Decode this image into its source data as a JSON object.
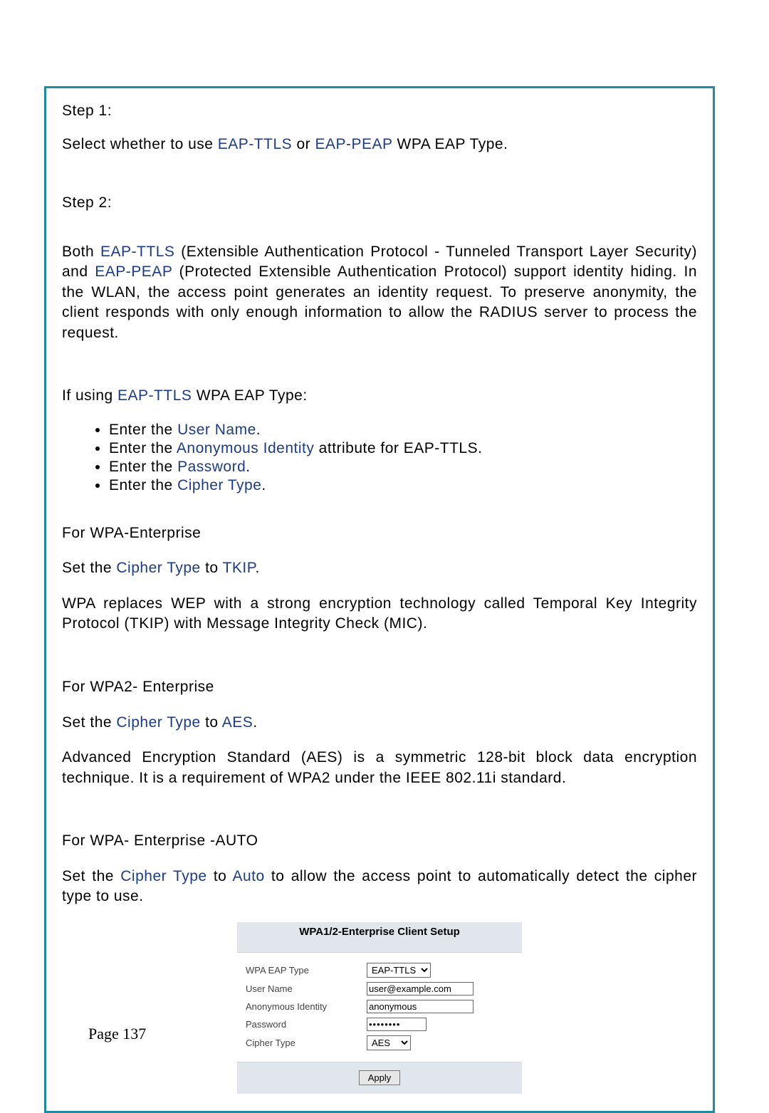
{
  "step1": {
    "title": "Step 1:",
    "text_before": "Select whether to use ",
    "link1": "EAP-TTLS",
    "text_mid": " or ",
    "link2": "EAP-PEAP",
    "text_after": " WPA EAP Type."
  },
  "step2": {
    "title": "Step 2:",
    "para_a": "Both ",
    "link1": "EAP-TTLS",
    "para_b": " (Extensible Authentication Protocol - Tunneled Transport Layer Security) and ",
    "link2": "EAP-PEAP",
    "para_c": " (Protected Extensible Authentication Protocol) support identity hiding. In the WLAN, the access point generates an identity request. To preserve anonymity, the client responds with only enough information to allow the RADIUS server to process the request."
  },
  "ttls_intro_a": "If using ",
  "ttls_intro_link": "EAP-TTLS",
  "ttls_intro_b": " WPA EAP Type:",
  "bullets": [
    {
      "pre": "Enter the ",
      "link": "User Name",
      "post": "."
    },
    {
      "pre": "Enter the ",
      "link": "Anonymous Identity",
      "post": " attribute for EAP-TTLS."
    },
    {
      "pre": "Enter the ",
      "link": "Password",
      "post": "."
    },
    {
      "pre": "Enter the ",
      "link": "Cipher Type",
      "post": "."
    }
  ],
  "wpa1": {
    "head": "For WPA-Enterprise",
    "set_a": "Set the ",
    "set_link1": "Cipher Type",
    "set_b": " to ",
    "set_link2": "TKIP",
    "set_c": ".",
    "body": "WPA replaces WEP with a strong encryption technology called Temporal Key Integrity Protocol (TKIP) with Message Integrity Check (MIC)."
  },
  "wpa2": {
    "head": "For WPA2- Enterprise",
    "set_a": "Set the ",
    "set_link1": "Cipher Type",
    "set_b": " to ",
    "set_link2": "AES",
    "set_c": ".",
    "body": "Advanced Encryption Standard (AES) is a symmetric 128-bit block data encryption technique. It is a requirement of WPA2 under the IEEE 802.11i standard."
  },
  "wpaauto": {
    "head": "For WPA- Enterprise -AUTO",
    "set_a": "Set the ",
    "set_link1": "Cipher Type",
    "set_b": " to ",
    "set_link2": "Auto",
    "set_c": " to allow the access point to automatically detect the cipher type to use."
  },
  "form": {
    "title": "WPA1/2-Enterprise Client Setup",
    "rows": {
      "eap_label": "WPA EAP Type",
      "eap_value": "EAP-TTLS",
      "user_label": "User Name",
      "user_value": "user@example.com",
      "anon_label": "Anonymous Identity",
      "anon_value": "anonymous",
      "pass_label": "Password",
      "pass_value": "••••••••",
      "cipher_label": "Cipher Type",
      "cipher_value": "AES"
    },
    "apply": "Apply"
  },
  "page_number": "Page 137"
}
